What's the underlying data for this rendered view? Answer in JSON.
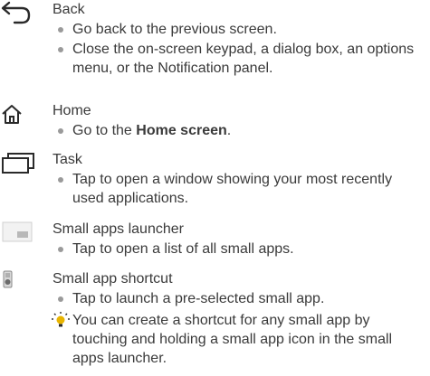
{
  "entries": [
    {
      "title": "Back",
      "icon": "back-arrow-icon",
      "bullets": [
        "Go back to the previous screen.",
        "Close the on-screen keypad, a dialog box, an options menu, or the Notification panel."
      ]
    },
    {
      "title": "Home",
      "icon": "home-icon",
      "bullet_prefix": "Go to the ",
      "bullet_bold": "Home screen",
      "bullet_suffix": "."
    },
    {
      "title": "Task",
      "icon": "task-icon",
      "bullets": [
        "Tap to open a window showing your most recently used applications."
      ]
    },
    {
      "title": "Small apps launcher",
      "icon": "small-apps-launcher-icon",
      "bullets": [
        "Tap to open a list of all small apps."
      ]
    },
    {
      "title": "Small app shortcut",
      "icon": "small-app-shortcut-icon",
      "bullets": [
        "Tap to launch a pre-selected small app."
      ],
      "tip": "You can create a shortcut for any small app by touching and holding a small app icon in the small apps launcher."
    }
  ],
  "colors": {
    "text": "#3a3a3a",
    "bullet": "#9a9a9a",
    "icon": "#2a2a2a",
    "tip_accent": "#e8b400"
  }
}
